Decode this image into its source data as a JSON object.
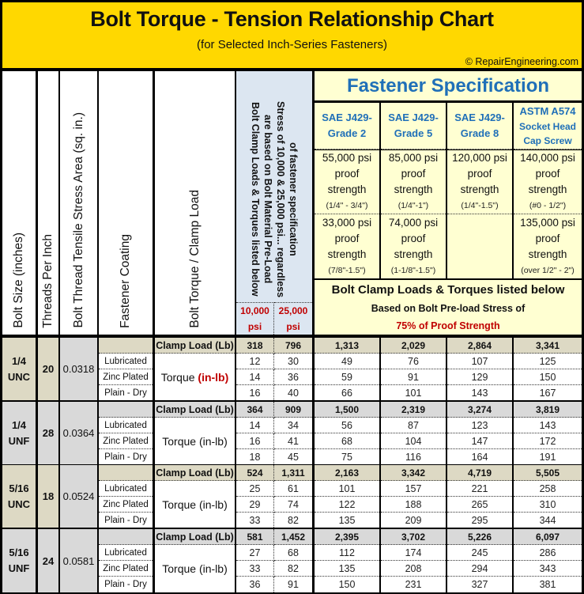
{
  "header": {
    "title": "Bolt Torque - Tension Relationship Chart",
    "subtitle": "(for Selected Inch-Series Fasteners)",
    "copyright": "© RepairEngineering.com"
  },
  "columns": {
    "bolt_size": "Bolt Size (inches)",
    "threads_per_inch": "Threads Per Inch",
    "stress_area": "Bolt Thread Tensile Stress Area (sq. in.)",
    "coating": "Fastener Coating",
    "torque_clamp": "Bolt Torque / Clamp Load",
    "preload_note_lines": [
      "Bolt Clamp Loads & Torques listed below",
      "are based on Bolt Material Pre-Load",
      "Stress of 10,000 & 25,000 psi... regardless",
      "of fastener specification"
    ],
    "psi_10k": {
      "value": "10,000",
      "unit": "psi"
    },
    "psi_25k": {
      "value": "25,000",
      "unit": "psi"
    }
  },
  "fastener_spec": {
    "title": "Fastener Specification",
    "grades": [
      {
        "line1": "SAE J429-",
        "line2": "Grade 2",
        "line3": ""
      },
      {
        "line1": "SAE J429-",
        "line2": "Grade 5",
        "line3": ""
      },
      {
        "line1": "SAE J429-",
        "line2": "Grade 8",
        "line3": ""
      },
      {
        "line1": "ASTM A574",
        "line2": "Socket Head",
        "line3": "Cap Screw"
      }
    ],
    "proof_row1": [
      {
        "psi": "55,000 psi",
        "l2": "proof",
        "l3": "strength",
        "range": "(1/4\" - 3/4\")"
      },
      {
        "psi": "85,000 psi",
        "l2": "proof",
        "l3": "strength",
        "range": "(1/4\"-1\")"
      },
      {
        "psi": "120,000 psi",
        "l2": "proof",
        "l3": "strength",
        "range": "(1/4\"-1.5\")"
      },
      {
        "psi": "140,000 psi",
        "l2": "proof",
        "l3": "strength",
        "range": "(#0 - 1/2\")"
      }
    ],
    "proof_row2": [
      {
        "psi": "33,000 psi",
        "l2": "proof",
        "l3": "strength",
        "range": "(7/8\"-1.5\")"
      },
      {
        "psi": "74,000 psi",
        "l2": "proof",
        "l3": "strength",
        "range": "(1-1/8\"-1.5\")"
      },
      {
        "psi": "",
        "l2": "",
        "l3": "",
        "range": ""
      },
      {
        "psi": "135,000 psi",
        "l2": "proof",
        "l3": "strength",
        "range": "(over 1/2\" - 2\")"
      }
    ],
    "note_line1": "Bolt Clamp Loads & Torques listed below",
    "note_line2": "Based on Bolt Pre-load Stress of",
    "note_line3": "75% of Proof Strength"
  },
  "labels": {
    "clamp_load": "Clamp Load (Lb)",
    "torque": "Torque",
    "torque_unit": "(in-lb)",
    "torque_full": "Torque (in-lb)",
    "coatings": [
      "Lubricated",
      "Zinc Plated",
      "Plain - Dry"
    ]
  },
  "table": {
    "groups": [
      {
        "size": "1/4",
        "series": "UNC",
        "tpi": "20",
        "area": "0.0318",
        "clamp": [
          "318",
          "796",
          "1,313",
          "2,029",
          "2,864",
          "3,341"
        ],
        "torque": [
          [
            "12",
            "30",
            "49",
            "76",
            "107",
            "125"
          ],
          [
            "14",
            "36",
            "59",
            "91",
            "129",
            "150"
          ],
          [
            "16",
            "40",
            "66",
            "101",
            "143",
            "167"
          ]
        ]
      },
      {
        "size": "1/4",
        "series": "UNF",
        "tpi": "28",
        "area": "0.0364",
        "clamp": [
          "364",
          "909",
          "1,500",
          "2,319",
          "3,274",
          "3,819"
        ],
        "torque": [
          [
            "14",
            "34",
            "56",
            "87",
            "123",
            "143"
          ],
          [
            "16",
            "41",
            "68",
            "104",
            "147",
            "172"
          ],
          [
            "18",
            "45",
            "75",
            "116",
            "164",
            "191"
          ]
        ]
      },
      {
        "size": "5/16",
        "series": "UNC",
        "tpi": "18",
        "area": "0.0524",
        "clamp": [
          "524",
          "1,311",
          "2,163",
          "3,342",
          "4,719",
          "5,505"
        ],
        "torque": [
          [
            "25",
            "61",
            "101",
            "157",
            "221",
            "258"
          ],
          [
            "29",
            "74",
            "122",
            "188",
            "265",
            "310"
          ],
          [
            "33",
            "82",
            "135",
            "209",
            "295",
            "344"
          ]
        ]
      },
      {
        "size": "5/16",
        "series": "UNF",
        "tpi": "24",
        "area": "0.0581",
        "clamp": [
          "581",
          "1,452",
          "2,395",
          "3,702",
          "5,226",
          "6,097"
        ],
        "torque": [
          [
            "27",
            "68",
            "112",
            "174",
            "245",
            "286"
          ],
          [
            "33",
            "82",
            "135",
            "208",
            "294",
            "343"
          ],
          [
            "36",
            "91",
            "150",
            "231",
            "327",
            "381"
          ]
        ]
      }
    ]
  }
}
